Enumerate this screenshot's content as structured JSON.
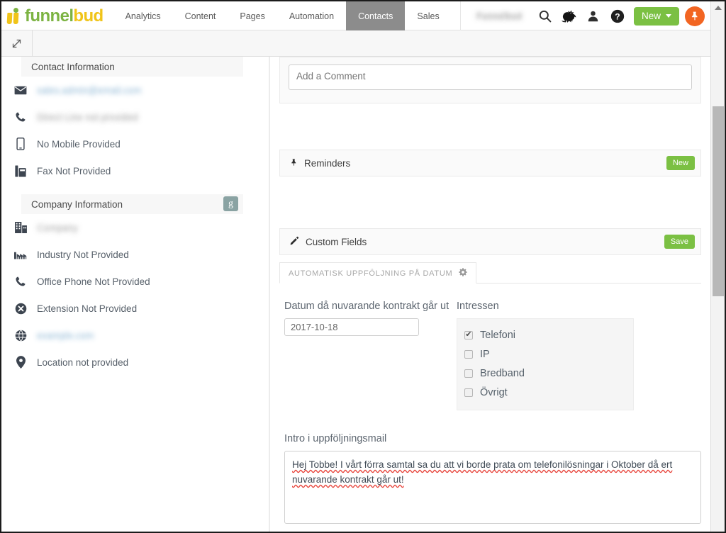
{
  "header": {
    "logo": {
      "green": "funnel",
      "yellow": "bud"
    },
    "nav": [
      {
        "label": "Analytics",
        "active": false
      },
      {
        "label": "Content",
        "active": false
      },
      {
        "label": "Pages",
        "active": false
      },
      {
        "label": "Automation",
        "active": false
      },
      {
        "label": "Contacts",
        "active": true
      },
      {
        "label": "Sales",
        "active": false
      }
    ],
    "account_name": "Funnelbud",
    "icons": [
      {
        "name": "search-icon",
        "glyph": "search"
      },
      {
        "name": "griffin-icon",
        "glyph": "griffin"
      },
      {
        "name": "user-icon",
        "glyph": "user"
      },
      {
        "name": "help-icon",
        "glyph": "help"
      }
    ],
    "new_button": "New",
    "pin_button": "pin-icon",
    "accent_green": "#7bc043",
    "accent_orange": "#f26522"
  },
  "subbar": {
    "expand_icon": "expand-icon"
  },
  "sidebar": {
    "contact_section": {
      "title": "Contact Information",
      "rows": [
        {
          "icon": "envelope-icon",
          "label": "sales.admin@email.com",
          "redacted": true,
          "blue": true
        },
        {
          "icon": "phone-icon",
          "label": "Direct Line not provided",
          "redacted": true,
          "blue": false
        },
        {
          "icon": "mobile-icon",
          "label": "No Mobile Provided",
          "redacted": false,
          "blue": false
        },
        {
          "icon": "fax-icon",
          "label": "Fax Not Provided",
          "redacted": false,
          "blue": false
        }
      ]
    },
    "company_section": {
      "title": "Company Information",
      "google_badge": "g",
      "rows": [
        {
          "icon": "building-icon",
          "label": "Company",
          "redacted": true,
          "blue": false
        },
        {
          "icon": "factory-icon",
          "label": "Industry Not Provided",
          "redacted": false,
          "blue": false
        },
        {
          "icon": "phone-icon",
          "label": "Office Phone Not Provided",
          "redacted": false,
          "blue": false
        },
        {
          "icon": "times-circle-icon",
          "label": "Extension Not Provided",
          "redacted": false,
          "blue": false
        },
        {
          "icon": "globe-icon",
          "label": "example.com",
          "redacted": true,
          "blue": true
        },
        {
          "icon": "map-marker-icon",
          "label": "Location not provided",
          "redacted": false,
          "blue": false
        }
      ]
    }
  },
  "main": {
    "comment": {
      "placeholder": "Add a Comment",
      "value": ""
    },
    "reminders": {
      "title": "Reminders",
      "icon": "pin-icon",
      "button": "New"
    },
    "custom_fields": {
      "title": "Custom Fields",
      "icon": "pencil-icon",
      "button": "Save"
    },
    "tab": {
      "label": "AUTOMATISK UPPFÖLJNING PÅ DATUM",
      "gear_icon": "gear-icon"
    },
    "date_field": {
      "label": "Datum då nuvarande kontrakt går ut",
      "value": "2017-10-18"
    },
    "interests": {
      "label": "Intressen",
      "options": [
        {
          "label": "Telefoni",
          "checked": true
        },
        {
          "label": "IP",
          "checked": false
        },
        {
          "label": "Bredband",
          "checked": false
        },
        {
          "label": "Övrigt",
          "checked": false
        }
      ]
    },
    "intro_field": {
      "label": "Intro i uppföljningsmail",
      "value": "Hej Tobbe! I vårt förra samtal sa du att vi borde prata om telefonilösningar i Oktober då ert nuvarande kontrakt går ut!"
    }
  },
  "scrollbar": {
    "up_arrow": "scroll-up-arrow"
  }
}
